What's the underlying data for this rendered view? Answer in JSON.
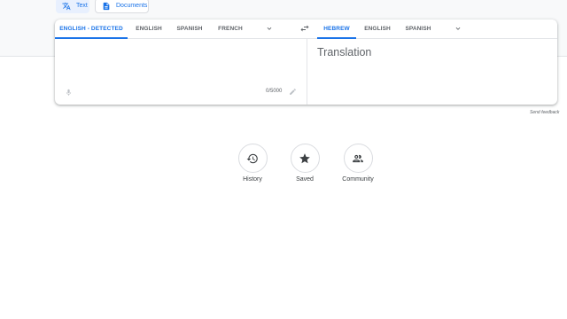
{
  "modes": {
    "text_label": "Text",
    "documents_label": "Documents"
  },
  "source_langs": {
    "detected": "ENGLISH - DETECTED",
    "items": [
      "ENGLISH",
      "SPANISH",
      "FRENCH"
    ]
  },
  "target_langs": {
    "items": [
      "HEBREW",
      "ENGLISH",
      "SPANISH"
    ]
  },
  "source": {
    "counter": "0/5000"
  },
  "target": {
    "placeholder": "Translation"
  },
  "feedback_link": "Send feedback",
  "actions": [
    {
      "label": "History",
      "icon": "history-icon"
    },
    {
      "label": "Saved",
      "icon": "star-icon"
    },
    {
      "label": "Community",
      "icon": "community-icon"
    }
  ],
  "colors": {
    "accent": "#1a73e8",
    "text_secondary": "#5f6368",
    "band": "#f8f9fa"
  }
}
